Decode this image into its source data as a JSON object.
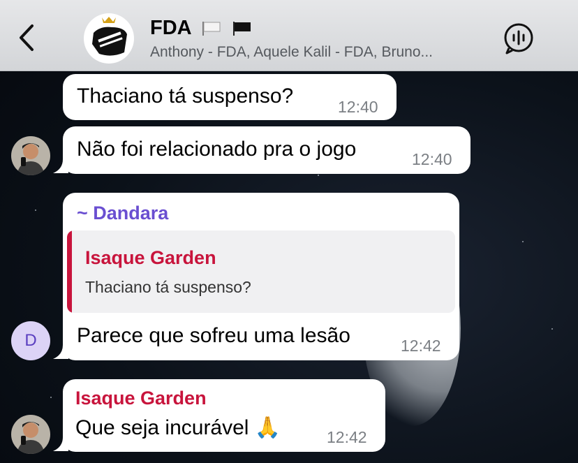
{
  "header": {
    "title": "FDA",
    "flags": [
      "white-flag-icon",
      "black-flag-icon"
    ],
    "subtitle": "Anthony - FDA, Aquele Kalil - FDA, Bruno..."
  },
  "messages": [
    {
      "id": "m1",
      "text": "Thaciano tá suspenso?",
      "time": "12:40"
    },
    {
      "id": "m2",
      "text": "Não foi relacionado pra o jogo",
      "time": "12:40"
    },
    {
      "id": "m3",
      "sender": "~ Dandara",
      "reply": {
        "name": "Isaque Garden",
        "text": "Thaciano tá suspenso?"
      },
      "text": "Parece que sofreu uma lesão",
      "time": "12:42",
      "avatar_letter": "D"
    },
    {
      "id": "m4",
      "sender": "Isaque Garden",
      "text": "Que seja incurável 🙏",
      "time": "12:42"
    }
  ],
  "colors": {
    "dandara": "#6a4fd1",
    "isaque": "#c8143c",
    "header_bg": "#dcdde0"
  }
}
